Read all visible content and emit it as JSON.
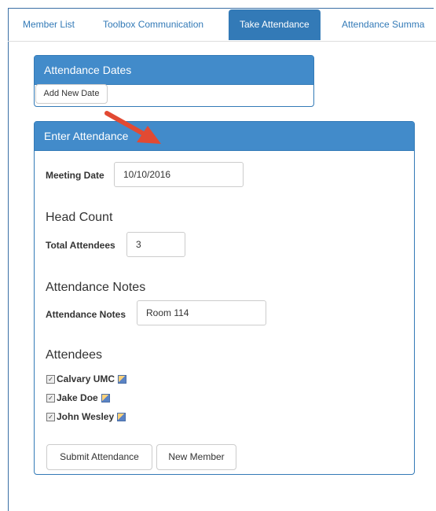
{
  "tabs": [
    {
      "label": "Member List"
    },
    {
      "label": "Toolbox Communication"
    },
    {
      "label": "Take Attendance"
    },
    {
      "label": "Attendance Summa"
    }
  ],
  "dates_panel": {
    "title": "Attendance Dates",
    "add_button": "Add New Date"
  },
  "enter_panel": {
    "title": "Enter Attendance",
    "meeting_date_label": "Meeting Date",
    "meeting_date_value": "10/10/2016",
    "head_count_heading": "Head Count",
    "total_attendees_label": "Total Attendees",
    "total_attendees_value": "3",
    "notes_heading": "Attendance Notes",
    "notes_label": "Attendance Notes",
    "notes_value": "Room 114",
    "attendees_heading": "Attendees",
    "attendees": [
      {
        "name": "Calvary UMC",
        "checked": true
      },
      {
        "name": "Jake Doe",
        "checked": true
      },
      {
        "name": "John Wesley",
        "checked": true
      }
    ],
    "submit_button": "Submit Attendance",
    "new_member_button": "New Member"
  },
  "colors": {
    "primary": "#337ab7",
    "panel_heading": "#428bca",
    "arrow": "#e24a33"
  }
}
